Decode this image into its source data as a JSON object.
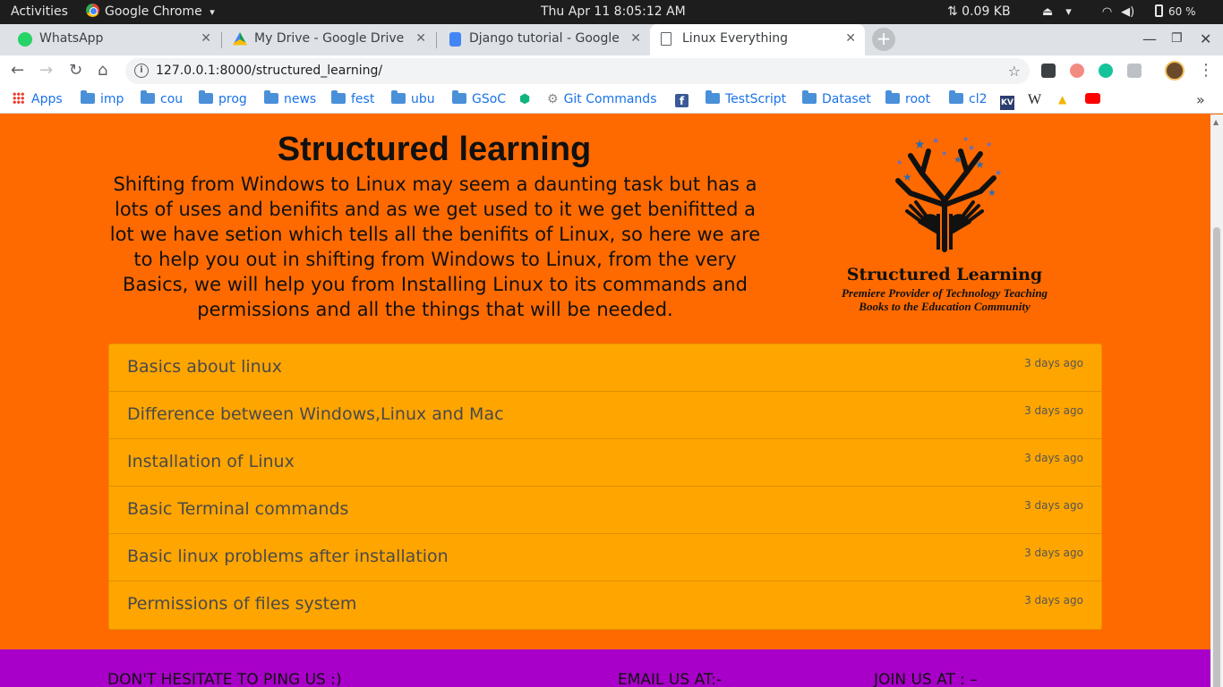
{
  "system_bar": {
    "activities": "Activities",
    "app_name": "Google Chrome",
    "app_menu_arrow": "▾",
    "clock": "Thu Apr 11   8:05:12 AM",
    "network_speed": "⇅ 0.09 KB",
    "battery": "60 %"
  },
  "tabs": [
    {
      "title": "WhatsApp",
      "icon": "whatsapp-icon",
      "color": "#25d366",
      "active": false
    },
    {
      "title": "My Drive - Google Drive",
      "icon": "google-drive-icon",
      "color": "#fbbc05",
      "active": false
    },
    {
      "title": "Django tutorial - Google D",
      "icon": "google-docs-icon",
      "color": "#4285f4",
      "active": false
    },
    {
      "title": "Linux Everything",
      "icon": "page-icon",
      "color": "#ffffff",
      "active": true
    }
  ],
  "tab_close_glyph": "✕",
  "new_tab_glyph": "+",
  "address_bar": {
    "url": "127.0.0.1:8000/structured_learning/"
  },
  "bookmarks": [
    {
      "label": "Apps",
      "type": "apps"
    },
    {
      "label": "imp",
      "type": "folder"
    },
    {
      "label": "cou",
      "type": "folder"
    },
    {
      "label": "prog",
      "type": "folder"
    },
    {
      "label": "news",
      "type": "folder"
    },
    {
      "label": "fest",
      "type": "folder"
    },
    {
      "label": "ubu",
      "type": "folder"
    },
    {
      "label": "GSoC",
      "type": "folder"
    },
    {
      "label": "",
      "type": "site"
    },
    {
      "label": "Git Commands",
      "type": "site"
    },
    {
      "label": "",
      "type": "site"
    },
    {
      "label": "TestScript",
      "type": "folder"
    },
    {
      "label": "Dataset",
      "type": "folder"
    },
    {
      "label": "root",
      "type": "folder"
    },
    {
      "label": "cl2",
      "type": "folder"
    },
    {
      "label": "",
      "type": "site"
    },
    {
      "label": "W",
      "type": "site"
    },
    {
      "label": "",
      "type": "site"
    },
    {
      "label": "",
      "type": "site"
    }
  ],
  "page": {
    "heading": "Structured learning",
    "intro": "Shifting from Windows to Linux may seem a daunting task but has a lots of uses and benifits and as we get used to it we get benifitted a lot we have setion which tells all the benifits of Linux, so here we are to help you out in shifting from Windows to Linux, from the very Basics, we will help you from Installing Linux to its commands and permissions and all the things that will be needed.",
    "logo": {
      "brand": "Structured Learning",
      "tagline_1": "Premiere Provider of Technology Teaching",
      "tagline_2": "Books to the Education Community"
    },
    "topics": [
      {
        "title": "Basics about linux",
        "time": "3 days ago"
      },
      {
        "title": "Difference between Windows,Linux and Mac",
        "time": "3 days ago"
      },
      {
        "title": "Installation of Linux",
        "time": "3 days ago"
      },
      {
        "title": "Basic Terminal commands",
        "time": "3 days ago"
      },
      {
        "title": "Basic linux problems after installation",
        "time": "3 days ago"
      },
      {
        "title": "Permissions of files system",
        "time": "3 days ago"
      }
    ],
    "footer": {
      "ping": "DON'T HESITATE TO PING US :)",
      "email": "EMAIL US AT:-",
      "join": "JOIN US AT : –"
    }
  },
  "colors": {
    "page_bg": "#ff6a00",
    "list_bg": "#ffa500",
    "footer_bg": "#a800c8"
  }
}
